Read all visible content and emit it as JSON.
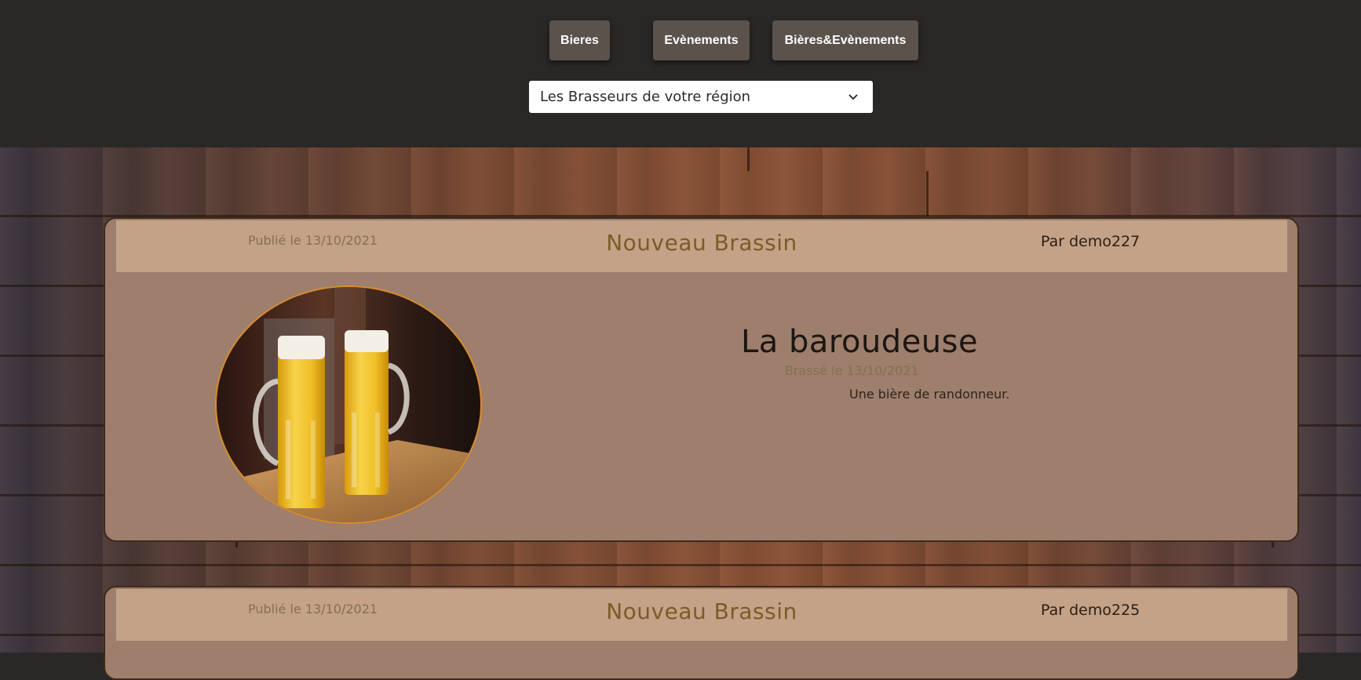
{
  "nav": {
    "bieres": "Bieres",
    "evenements": "Evènements",
    "bieres_evenements": "Bières&Evènements"
  },
  "region_select": {
    "selected": "Les Brasseurs de votre région"
  },
  "posts": [
    {
      "published": "Publié le 13/10/2021",
      "headline": "Nouveau Brassin",
      "author": "Par demo227",
      "beer_name": "La baroudeuse",
      "brew_date": "Brassé le 13/10/2021",
      "description": "Une bière de randonneur."
    },
    {
      "published": "Publié le 13/10/2021",
      "headline": "Nouveau Brassin",
      "author": "Par demo225"
    }
  ],
  "colors": {
    "header_bg": "#2a2827",
    "button_bg": "#5b524b",
    "card_bg": "#9e7e6c",
    "card_header_bg": "#c4a287",
    "accent_gold": "#7d5a29",
    "photo_border": "#d98c2d"
  },
  "icons": {
    "select_arrow": "chevron-down-icon",
    "beer_image": "beer-glasses-image"
  }
}
